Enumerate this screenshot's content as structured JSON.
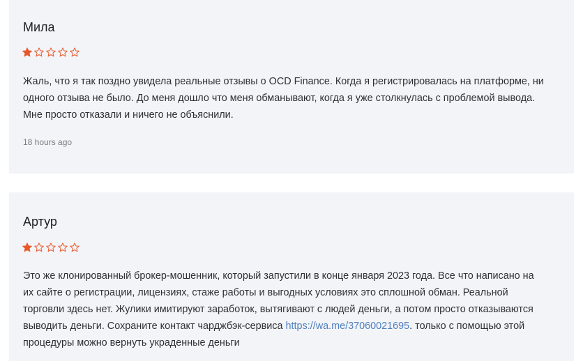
{
  "colors": {
    "star": "#e8582a",
    "card_bg": "#f3f4f8",
    "link": "#4e7fbf"
  },
  "reviews": [
    {
      "author": "Мила",
      "rating": 1,
      "max_rating": 5,
      "text_lines": [
        "Жаль, что я так поздно увидела реальные отзывы о OCD Finance. Когда я регистрировалась на платформе, ни",
        "одного отзыва не было. До меня дошло что меня обманывают, когда я уже столкнулась с проблемой вывода.",
        "Мне просто отказали и ничего не объяснили."
      ],
      "time": "18 hours ago"
    },
    {
      "author": "Артур",
      "rating": 1,
      "max_rating": 5,
      "text_lines": [
        "Это же клонированный брокер-мошенник, который запустили в конце января 2023 года. Все что написано на",
        "их сайте о регистрации, лицензиях, стаже работы и выгодных условиях это сплошной обман. Реальной",
        "торговли здесь нет. Жулики имитируют заработок, вытягивают с людей деньги, а потом просто отказываются"
      ],
      "text_line4_before_link": "выводить деньги. Сохраните контакт чарджбэк-сервиса ",
      "link_text": "https://wa.me/37060021695",
      "text_line4_after_link": ". только с помощью этой",
      "text_line5": "процедуры можно вернуть украденные деньги"
    }
  ]
}
